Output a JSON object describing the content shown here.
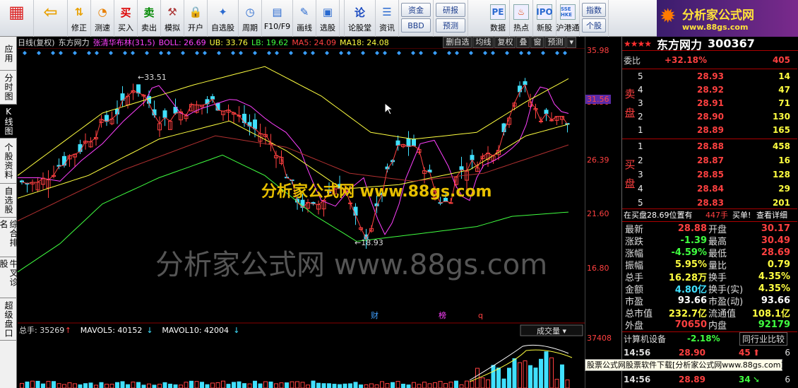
{
  "toolbar": {
    "items": [
      {
        "label": "",
        "icon": "logo-icon"
      },
      {
        "label": "",
        "icon": "back-arrow-icon"
      },
      {
        "label": "修正",
        "icon": "up-down-icon"
      },
      {
        "label": "测速",
        "icon": "speed-icon"
      },
      {
        "label": "买入",
        "glyph": "买"
      },
      {
        "label": "卖出",
        "glyph": "卖"
      },
      {
        "label": "模拟",
        "icon": "hammer-icon"
      },
      {
        "label": "开户",
        "icon": "lock-icon"
      },
      {
        "label": "自选股",
        "icon": "star-icon"
      },
      {
        "label": "周期",
        "icon": "clock-icon"
      },
      {
        "label": "F10/F9",
        "icon": "chart-icon"
      },
      {
        "label": "画线",
        "icon": "pen-icon"
      },
      {
        "label": "选股",
        "icon": "screen-icon"
      },
      {
        "label": "论股堂",
        "glyph": "论"
      },
      {
        "label": "资讯",
        "icon": "news-icon"
      }
    ],
    "small_buttons": [
      "资金",
      "BBD",
      "研报",
      "预测"
    ],
    "right_items": [
      {
        "label": "数据",
        "icon": "pe-icon",
        "glyph": "PE"
      },
      {
        "label": "热点",
        "icon": "fire-icon"
      },
      {
        "label": "新股",
        "icon": "ipo-icon"
      },
      {
        "label": "沪港通",
        "icon": "hk-icon",
        "glyph": "SSE HKE"
      }
    ],
    "index_label": "指数",
    "personal_label": "个股"
  },
  "brand": {
    "name": "分析家公式网",
    "url": "www.88gs.com"
  },
  "left_tabs": [
    "应用",
    "分时图",
    "K线图",
    "个股资料",
    "自选股",
    "综合排名",
    "牛叉诊股",
    "超级盘口"
  ],
  "active_tab": 2,
  "chart": {
    "legend": [
      {
        "text": "日线(复权)",
        "color": "#dddddd"
      },
      {
        "text": "东方网力",
        "color": "#dddddd"
      },
      {
        "text": "张清华布林(31,5)",
        "color": "#ff40ff"
      },
      {
        "text": "BOLL: 26.69",
        "color": "#ff40ff"
      },
      {
        "text": "UB: 33.76",
        "color": "#ffff40"
      },
      {
        "text": "LB: 19.62",
        "color": "#40ff40"
      },
      {
        "text": "MA5: 24.09",
        "color": "#ff4040"
      },
      {
        "text": "MA18: 24.08",
        "color": "#ffff40"
      }
    ],
    "buttons": [
      "删自选",
      "均线",
      "复权",
      "叠",
      "窗",
      "预测"
    ],
    "price_labels": [
      "35.98",
      "31.56",
      "26.39",
      "21.60",
      "16.80"
    ],
    "current_price_tag": "31.56",
    "high_label": "33.51",
    "low_label": "18.93",
    "watermark": "分析家公式网 www.88gs.com",
    "watermark_small": "分析家公式网 www.88gs.com",
    "event_markers": [
      {
        "text": "财",
        "color": "#40a0ff"
      },
      {
        "text": "榜",
        "color": "#ff40ff"
      },
      {
        "text": "q",
        "color": "#ff4040"
      }
    ],
    "volume_legend": [
      {
        "text": "总手: 35269",
        "color": "#dddddd",
        "arrow": "↑",
        "arrow_color": "#ff4040"
      },
      {
        "text": "MAVOL5: 40152",
        "color": "#ffffff",
        "arrow": "↓",
        "arrow_color": "#40e0ff"
      },
      {
        "text": "MAVOL10: 42004",
        "color": "#ffffff",
        "arrow": "↓",
        "arrow_color": "#40e0ff"
      }
    ],
    "volume_select": "成交量",
    "volume_axis": "37408"
  },
  "quote": {
    "stars": "★★★★",
    "name": "东方网力",
    "code": "300367",
    "weibi_label": "委比",
    "weibi_value": "+32.18%",
    "weicha": "405",
    "sell_label": "卖盘",
    "buy_label": "买盘",
    "sell": [
      {
        "level": "5",
        "price": "28.93",
        "vol": "14"
      },
      {
        "level": "4",
        "price": "28.92",
        "vol": "47"
      },
      {
        "level": "3",
        "price": "28.91",
        "vol": "71"
      },
      {
        "level": "2",
        "price": "28.90",
        "vol": "130"
      },
      {
        "level": "1",
        "price": "28.89",
        "vol": "165"
      }
    ],
    "buy": [
      {
        "level": "1",
        "price": "28.88",
        "vol": "458"
      },
      {
        "level": "2",
        "price": "28.87",
        "vol": "16"
      },
      {
        "level": "3",
        "price": "28.85",
        "vol": "128"
      },
      {
        "level": "4",
        "price": "28.84",
        "vol": "29"
      },
      {
        "level": "5",
        "price": "28.83",
        "vol": "201"
      }
    ],
    "status_line": "在买盘28.69位置有",
    "status_count": "447手",
    "status_action": "买单!",
    "status_link": "查看详细",
    "stats": [
      {
        "k1": "最新",
        "v1": "28.88",
        "c1": "red",
        "k2": "开盘",
        "v2": "30.17",
        "c2": "red"
      },
      {
        "k1": "涨跌",
        "v1": "-1.39",
        "c1": "grn",
        "k2": "最高",
        "v2": "30.49",
        "c2": "red"
      },
      {
        "k1": "涨幅",
        "v1": "-4.59%",
        "c1": "grn",
        "k2": "最低",
        "v2": "28.69",
        "c2": "red"
      },
      {
        "k1": "振幅",
        "v1": "5.95%",
        "c1": "yel",
        "k2": "量比",
        "v2": "0.79",
        "c2": "yel"
      },
      {
        "k1": "总手",
        "v1": "16.28万",
        "c1": "yel",
        "k2": "换手",
        "v2": "4.35%",
        "c2": "yel"
      },
      {
        "k1": "金额",
        "v1": "4.80亿",
        "c1": "cyan",
        "k2": "换手(实)",
        "v2": "4.35%",
        "c2": "yel"
      },
      {
        "k1": "市盈",
        "v1": "93.66",
        "c1": "wht",
        "k2": "市盈(动)",
        "v2": "93.66",
        "c2": "wht"
      },
      {
        "k1": "总市值",
        "v1": "232.7亿",
        "c1": "yel",
        "k2": "流通值",
        "v2": "108.1亿",
        "c2": "yel"
      },
      {
        "k1": "外盘",
        "v1": "70650",
        "c1": "red",
        "k2": "内盘",
        "v2": "92179",
        "c2": "grn"
      }
    ],
    "industry": "计算机设备",
    "industry_change": "-2.18%",
    "industry_button": "同行业比较",
    "ticks": [
      {
        "time": "14:56",
        "price": "28.90",
        "vol": "45",
        "flag": "6"
      },
      {
        "time": "14:56",
        "price": "28.89",
        "vol": "34",
        "flag": "6"
      }
    ]
  },
  "footer": "股票公式网股票软件下载[分析家公式网www.88gs.com]",
  "colors": {
    "up": "#ff4040",
    "down": "#40e0ff",
    "boll": "#ff40ff",
    "ub": "#ffff40",
    "lb": "#40ff40"
  }
}
